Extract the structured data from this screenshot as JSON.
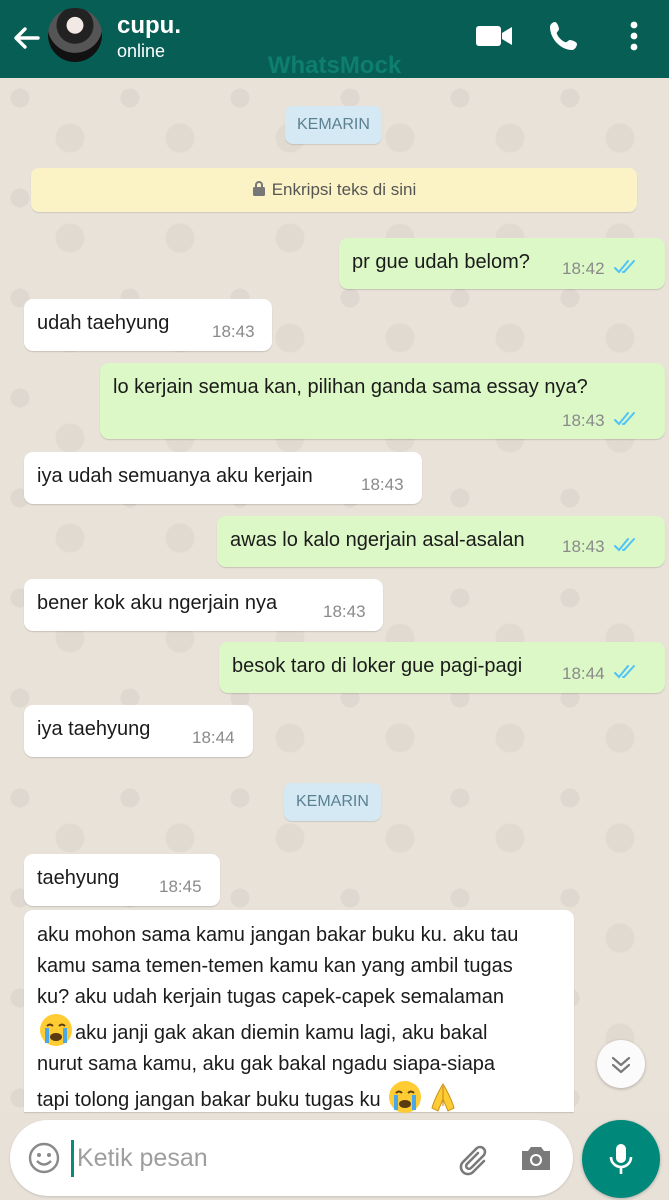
{
  "header": {
    "contact_name": "cupu.",
    "status": "online",
    "watermark": "WhatsMock",
    "icons": [
      "back-arrow-icon",
      "video-call-icon",
      "phone-icon",
      "more-vert-icon"
    ]
  },
  "chat": {
    "date_chips": [
      "KEMARIN",
      "KEMARIN"
    ],
    "encryption_notice": "Enkripsi teks di sini",
    "messages": [
      {
        "dir": "out",
        "text": "pr gue udah belom?",
        "time": "18:42",
        "read": true
      },
      {
        "dir": "in",
        "text": "udah taehyung",
        "time": "18:43"
      },
      {
        "dir": "out",
        "text": "lo kerjain semua kan, pilihan ganda sama essay nya?",
        "time": "18:43",
        "read": true
      },
      {
        "dir": "in",
        "text": "iya udah semuanya aku kerjain",
        "time": "18:43"
      },
      {
        "dir": "out",
        "text": "awas lo kalo ngerjain asal-asalan",
        "time": "18:43",
        "read": true
      },
      {
        "dir": "in",
        "text": "bener kok aku ngerjain nya",
        "time": "18:43"
      },
      {
        "dir": "out",
        "text": "besok taro di loker gue pagi-pagi",
        "time": "18:44",
        "read": true
      },
      {
        "dir": "in",
        "text": "iya taehyung",
        "time": "18:44"
      },
      {
        "dir": "in",
        "text": "taehyung",
        "time": "18:45"
      }
    ],
    "long_message": {
      "line1": "aku mohon sama kamu jangan bakar buku ku. aku tau",
      "line2": "kamu sama temen-temen kamu kan yang ambil tugas",
      "line3": "ku? aku udah kerjain tugas capek-capek semalaman",
      "line4_after_emoji": "aku janji gak akan diemin kamu lagi, aku bakal",
      "line5": "nurut sama kamu, aku gak bakal ngadu siapa-siapa",
      "line6": "tapi tolong jangan bakar buku tugas ku",
      "emojis": [
        "crying-face",
        "crying-face",
        "folded-hands"
      ]
    }
  },
  "composer": {
    "placeholder": "Ketik pesan"
  },
  "colors": {
    "header": "#075e54",
    "outgoing_bubble": "#dcf8c6",
    "incoming_bubble": "#ffffff",
    "read_ticks": "#4fc3f7",
    "mic_button": "#00897b"
  }
}
